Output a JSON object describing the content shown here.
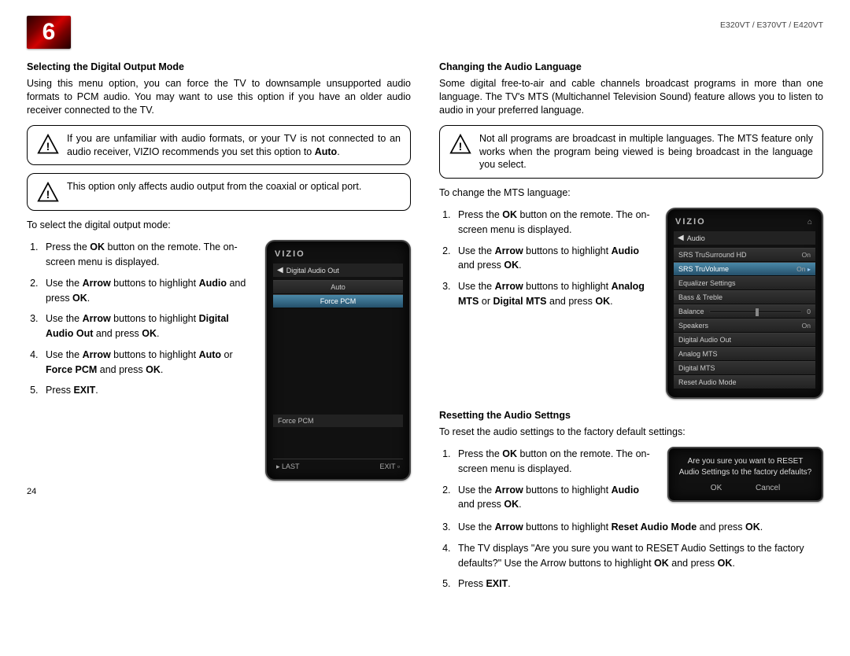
{
  "header": {
    "chapter_number": "6",
    "model_line": "E320VT / E370VT / E420VT"
  },
  "left": {
    "h1": "Selecting the Digital Output Mode",
    "intro": "Using this menu option, you can force the TV to downsample unsupported audio formats to PCM audio. You may want to use this option if you have an older audio receiver connected to the TV.",
    "callout1_pre": "If you are unfamiliar with audio formats, or your TV is not connected to an audio receiver, VIZIO recommends you set this option to ",
    "callout1_bold": "Auto",
    "callout1_post": ".",
    "callout2": "This option only affects audio output from the coaxial or optical port.",
    "lead": "To select the digital output mode:",
    "steps": {
      "s1a": "Press the ",
      "s1b": "OK",
      "s1c": " button on the remote. The on-screen menu is displayed.",
      "s2a": "Use the ",
      "s2b": "Arrow",
      "s2c": " buttons to highlight ",
      "s2d": "Audio",
      "s2e": " and press ",
      "s2f": "OK",
      "s2g": ".",
      "s3a": "Use the ",
      "s3b": "Arrow",
      "s3c": " buttons to highlight ",
      "s3d": "Digital Audio Out",
      "s3e": " and press ",
      "s3f": "OK",
      "s3g": ".",
      "s4a": "Use the ",
      "s4b": "Arrow",
      "s4c": " buttons to highlight ",
      "s4d": "Auto",
      "s4e": " or ",
      "s4f": "Force PCM",
      "s4g": " and press ",
      "s4h": "OK",
      "s4i": ".",
      "s5a": "Press ",
      "s5b": "EXIT",
      "s5c": "."
    },
    "ui": {
      "brand": "VIZIO",
      "bread": "Digital Audio Out",
      "opt_auto": "Auto",
      "opt_pcm": "Force PCM",
      "footer_sel": "Force PCM",
      "last": "LAST",
      "last_sym": "▸",
      "exit": "EXIT",
      "exit_sym": "▫"
    }
  },
  "right": {
    "h1": "Changing the Audio Language",
    "intro": "Some digital free-to-air and cable channels broadcast programs in more than one language. The TV's MTS (Multichannel Television Sound) feature allows you to listen to audio in your preferred language.",
    "callout1": "Not all programs are broadcast in multiple languages. The MTS feature only works when the program being viewed is being broadcast in the language you select.",
    "lead1": "To change the MTS language:",
    "steps1": {
      "s1a": "Press the ",
      "s1b": "OK",
      "s1c": " button on the remote. The on-screen menu is displayed.",
      "s2a": "Use the ",
      "s2b": "Arrow",
      "s2c": " buttons to highlight ",
      "s2d": "Audio",
      "s2e": " and press ",
      "s2f": "OK",
      "s2g": ".",
      "s3a": "Use the ",
      "s3b": "Arrow",
      "s3c": " buttons to highlight ",
      "s3d": "Analog MTS",
      "s3e": " or ",
      "s3f": "Digital MTS",
      "s3g": " and press ",
      "s3h": "OK",
      "s3i": "."
    },
    "ui1": {
      "brand": "VIZIO",
      "home": "⌂",
      "bread_arrow": "◀",
      "bread": "Audio",
      "r1": "SRS TruSurround HD",
      "r1v": "On",
      "r2": "SRS TruVolume",
      "r2v": "On",
      "r2tri": "▸",
      "r3": "Equalizer Settings",
      "r4": "Bass & Treble",
      "r5": "Balance",
      "r5v": "0",
      "r6": "Speakers",
      "r6v": "On",
      "r7": "Digital Audio Out",
      "r8": "Analog MTS",
      "r9": "Digital MTS",
      "r10": "Reset Audio Mode"
    },
    "h2": "Resetting the Audio Settngs",
    "lead2": "To reset the audio settings to the factory default settings:",
    "steps2": {
      "s1a": "Press the ",
      "s1b": "OK",
      "s1c": " button on the remote. The on-screen menu is displayed.",
      "s2a": "Use the ",
      "s2b": "Arrow",
      "s2c": " buttons to highlight ",
      "s2d": "Audio",
      "s2e": " and press ",
      "s2f": "OK",
      "s2g": ".",
      "s3a": "Use the ",
      "s3b": "Arrow",
      "s3c": " buttons to highlight ",
      "s3d": "Reset Audio Mode",
      "s3e": " and press ",
      "s3f": "OK",
      "s3g": ".",
      "s4a": "The TV displays \"Are you sure you want to RESET Audio Settings to the factory defaults?\" Use the Arrow buttons to highlight ",
      "s4b": "OK",
      "s4c": " and press ",
      "s4d": "OK",
      "s4e": ".",
      "s5a": "Press ",
      "s5b": "EXIT",
      "s5c": "."
    },
    "ui2": {
      "msg": "Are you sure you want to RESET Audio Settings to the factory defaults?",
      "ok": "OK",
      "cancel": "Cancel"
    }
  },
  "page_number": "24"
}
